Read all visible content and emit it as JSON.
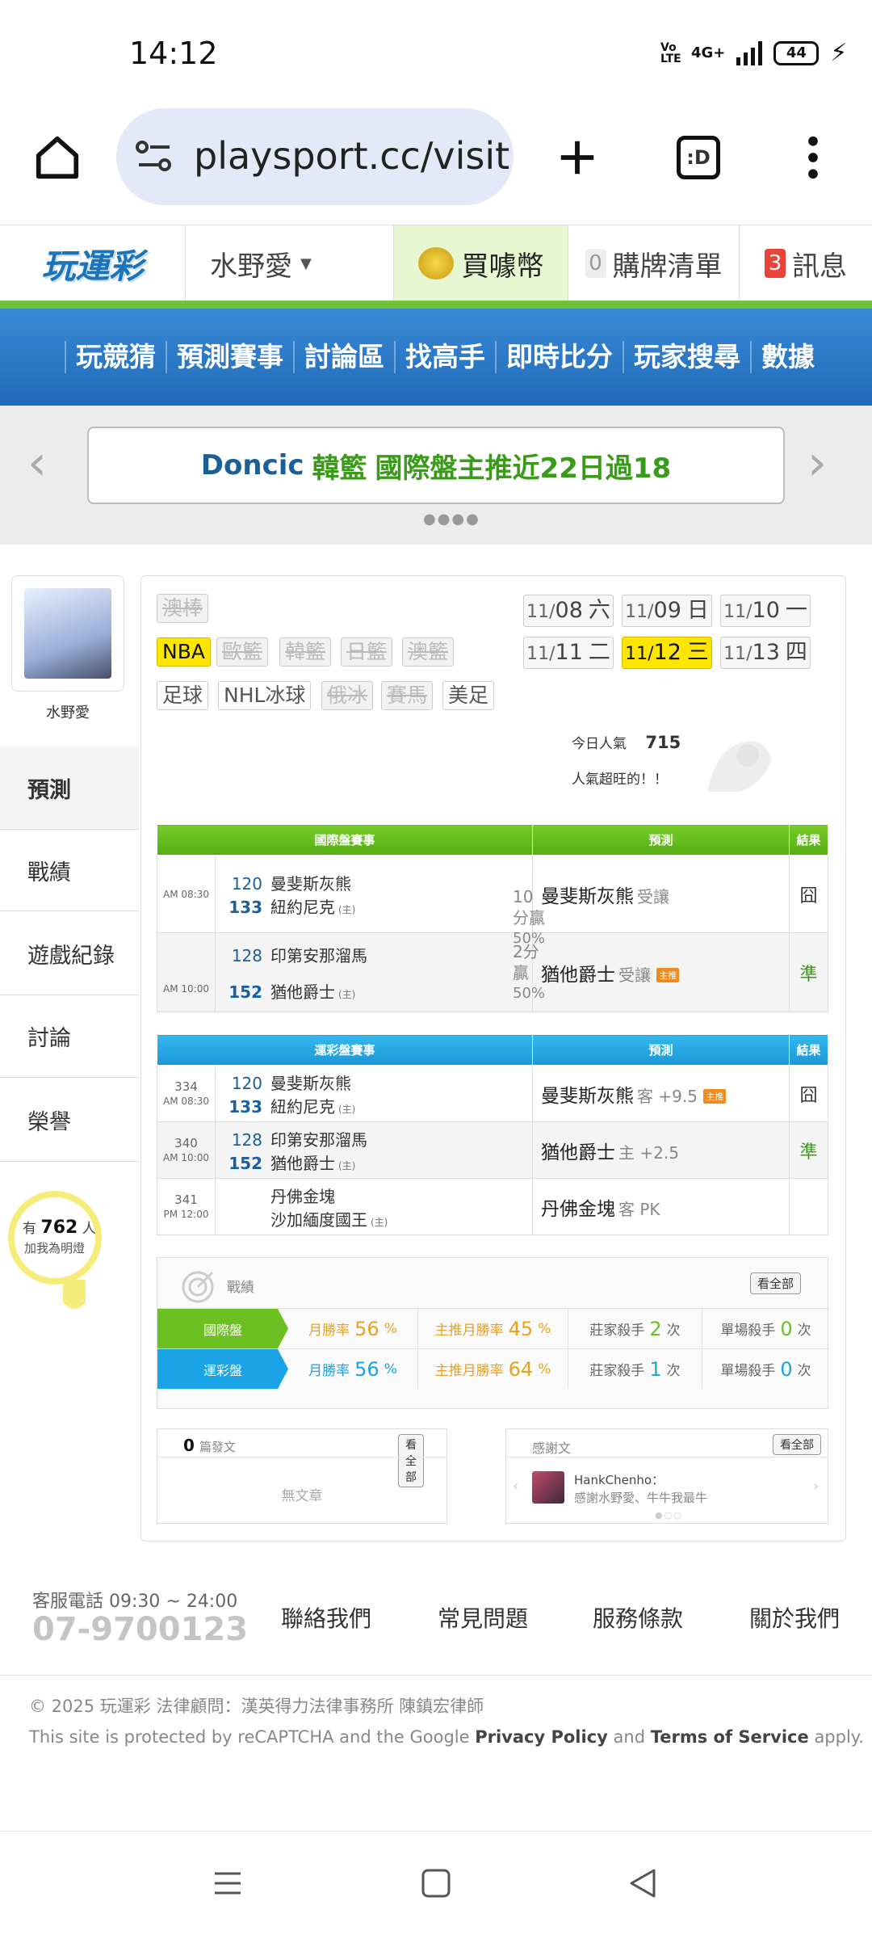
{
  "status": {
    "time": "14:12",
    "volte": "Vo LTE",
    "network": "4G+",
    "battery": "44"
  },
  "browser": {
    "url": "playsport.cc/visit"
  },
  "header": {
    "logo": "玩運彩",
    "user": "水野愛",
    "buy_label": "買噱幣",
    "cart_count": "0",
    "cart_label": "購牌清單",
    "msg_count": "3",
    "msg_label": "訊息"
  },
  "nav": [
    "玩競猜",
    "預測賽事",
    "討論區",
    "找高手",
    "即時比分",
    "玩家搜尋",
    "數據"
  ],
  "banner": {
    "part1": "Doncic",
    "part2": "韓籃",
    "part3": "國際盤主推近22日過18"
  },
  "profile": {
    "name": "水野愛"
  },
  "sidebar": {
    "items": [
      "預測",
      "戰績",
      "遊戲紀錄",
      "討論",
      "榮譽"
    ]
  },
  "lightbulb": {
    "prefix": "有",
    "count": "762",
    "suffix": "人",
    "line2": "加我為明燈"
  },
  "leagues": {
    "row0": [
      "澳棒"
    ],
    "row1": [
      "NBA",
      "歐籃",
      "韓籃",
      "日籃",
      "澳籃"
    ],
    "row2": [
      "足球",
      "NHL冰球",
      "俄冰",
      "賽馬",
      "美足"
    ]
  },
  "dates": [
    {
      "md": "11/",
      "d": "08",
      "w": "六"
    },
    {
      "md": "11/",
      "d": "09",
      "w": "日"
    },
    {
      "md": "11/",
      "d": "10",
      "w": "一"
    },
    {
      "md": "11/",
      "d": "11",
      "w": "二"
    },
    {
      "md": "11/",
      "d": "12",
      "w": "三"
    },
    {
      "md": "11/",
      "d": "13",
      "w": "四"
    }
  ],
  "popularity": {
    "label": "今日人氣",
    "value": "715",
    "note": "人氣超旺的！！"
  },
  "intl": {
    "headers": [
      "國際盤賽事",
      "預測",
      "結果"
    ],
    "games": [
      {
        "time": "AM 08:30",
        "away_no": "120",
        "away": "曼斐斯灰熊",
        "home_no": "133",
        "home": "紐約尼克",
        "host": "(主)",
        "line": "10分贏",
        "pct": "50%",
        "pred": "曼斐斯灰熊",
        "pred_sub": "受讓",
        "result": "囧"
      },
      {
        "time": "AM 10:00",
        "away_no": "128",
        "away": "印第安那溜馬",
        "home_no": "152",
        "home": "猶他爵士",
        "host": "(主)",
        "line": "2分贏",
        "pct": "50%",
        "pred": "猶他爵士",
        "pred_sub": "受讓",
        "badge": "主推",
        "result": "準"
      }
    ]
  },
  "lottery": {
    "headers": [
      "運彩盤賽事",
      "預測",
      "結果"
    ],
    "games": [
      {
        "code": "334",
        "time": "AM 08:30",
        "away_no": "120",
        "away": "曼斐斯灰熊",
        "home_no": "133",
        "home": "紐約尼克",
        "host": "(主)",
        "pred": "曼斐斯灰熊",
        "pred_sub": "客 +9.5",
        "badge": "主推",
        "result": "囧"
      },
      {
        "code": "340",
        "time": "AM 10:00",
        "away_no": "128",
        "away": "印第安那溜馬",
        "home_no": "152",
        "home": "猶他爵士",
        "host": "(主)",
        "pred": "猶他爵士",
        "pred_sub": "主 +2.5",
        "result": "準"
      },
      {
        "code": "341",
        "time": "PM 12:00",
        "away_no": "",
        "away": "丹佛金塊",
        "home_no": "",
        "home": "沙加緬度國王",
        "host": "(主)",
        "pred": "丹佛金塊",
        "pred_sub": "客 PK",
        "result": ""
      }
    ]
  },
  "stats": {
    "title": "戰績",
    "view_all": "看全部",
    "rows": [
      {
        "label": "國際盤",
        "month_rate_label": "月勝率",
        "month_rate": "56",
        "main_rate_label": "主推月勝率",
        "main_rate": "45",
        "killer_label": "莊家殺手",
        "killer": "2",
        "single_label": "單場殺手",
        "single": "0",
        "unit_pct": "%",
        "unit_times": "次",
        "color": "#6cc021"
      },
      {
        "label": "運彩盤",
        "month_rate_label": "月勝率",
        "month_rate": "56",
        "main_rate_label": "主推月勝率",
        "main_rate": "64",
        "killer_label": "莊家殺手",
        "killer": "1",
        "single_label": "單場殺手",
        "single": "0",
        "unit_pct": "%",
        "unit_times": "次",
        "color": "#1aa3e6"
      }
    ]
  },
  "posts": {
    "count": "0",
    "label": "篇發文",
    "view_all": "看全部",
    "empty": "無文章"
  },
  "thanks": {
    "label": "感謝文",
    "view_all": "看全部",
    "user": "HankChenho：",
    "text": "感謝水野愛、牛牛我最牛"
  },
  "footer": {
    "service_label": "客服電話 09:30 ~ 24:00",
    "phone": "07-9700123",
    "links": [
      "聯絡我們",
      "常見問題",
      "服務條款",
      "關於我們"
    ],
    "copyright": "© 2025 玩運彩 法律顧問：漢英得力法律事務所 陳鎮宏律師",
    "recaptcha_pre": "This site is protected by reCAPTCHA and the Google",
    "privacy": "Privacy Policy",
    "and": "and",
    "terms": "Terms of Service",
    "apply": "apply."
  },
  "colors": {
    "nav_blue": "#1f6ab8",
    "green": "#6cc021",
    "blue": "#1aa3e6",
    "orange": "#f08c1e",
    "yellow": "#ffe600"
  }
}
